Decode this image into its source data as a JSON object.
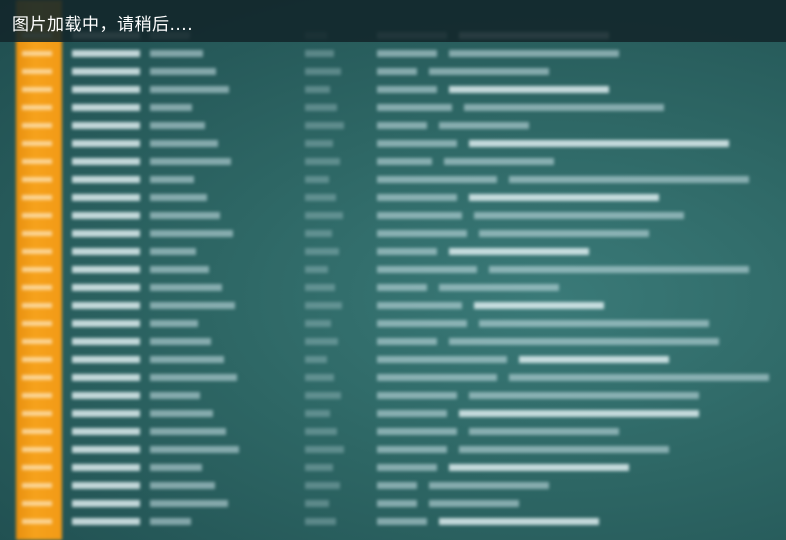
{
  "overlay": {
    "loading_message": "图片加载中，请稍后...."
  },
  "colors": {
    "gutter": "#f29a16",
    "background": "#2d6664",
    "topbar": "#12262a",
    "text": "#ffffff"
  }
}
